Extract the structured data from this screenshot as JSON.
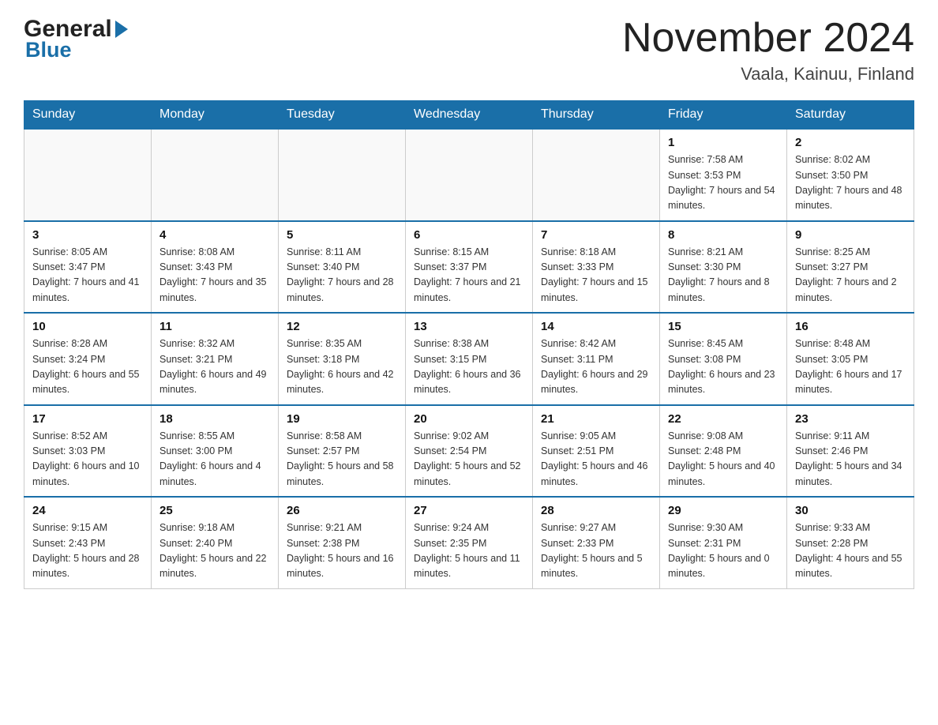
{
  "header": {
    "logo_general": "General",
    "logo_blue": "Blue",
    "month_title": "November 2024",
    "location": "Vaala, Kainuu, Finland"
  },
  "calendar": {
    "days_of_week": [
      "Sunday",
      "Monday",
      "Tuesday",
      "Wednesday",
      "Thursday",
      "Friday",
      "Saturday"
    ],
    "weeks": [
      [
        {
          "day": "",
          "info": ""
        },
        {
          "day": "",
          "info": ""
        },
        {
          "day": "",
          "info": ""
        },
        {
          "day": "",
          "info": ""
        },
        {
          "day": "",
          "info": ""
        },
        {
          "day": "1",
          "info": "Sunrise: 7:58 AM\nSunset: 3:53 PM\nDaylight: 7 hours and 54 minutes."
        },
        {
          "day": "2",
          "info": "Sunrise: 8:02 AM\nSunset: 3:50 PM\nDaylight: 7 hours and 48 minutes."
        }
      ],
      [
        {
          "day": "3",
          "info": "Sunrise: 8:05 AM\nSunset: 3:47 PM\nDaylight: 7 hours and 41 minutes."
        },
        {
          "day": "4",
          "info": "Sunrise: 8:08 AM\nSunset: 3:43 PM\nDaylight: 7 hours and 35 minutes."
        },
        {
          "day": "5",
          "info": "Sunrise: 8:11 AM\nSunset: 3:40 PM\nDaylight: 7 hours and 28 minutes."
        },
        {
          "day": "6",
          "info": "Sunrise: 8:15 AM\nSunset: 3:37 PM\nDaylight: 7 hours and 21 minutes."
        },
        {
          "day": "7",
          "info": "Sunrise: 8:18 AM\nSunset: 3:33 PM\nDaylight: 7 hours and 15 minutes."
        },
        {
          "day": "8",
          "info": "Sunrise: 8:21 AM\nSunset: 3:30 PM\nDaylight: 7 hours and 8 minutes."
        },
        {
          "day": "9",
          "info": "Sunrise: 8:25 AM\nSunset: 3:27 PM\nDaylight: 7 hours and 2 minutes."
        }
      ],
      [
        {
          "day": "10",
          "info": "Sunrise: 8:28 AM\nSunset: 3:24 PM\nDaylight: 6 hours and 55 minutes."
        },
        {
          "day": "11",
          "info": "Sunrise: 8:32 AM\nSunset: 3:21 PM\nDaylight: 6 hours and 49 minutes."
        },
        {
          "day": "12",
          "info": "Sunrise: 8:35 AM\nSunset: 3:18 PM\nDaylight: 6 hours and 42 minutes."
        },
        {
          "day": "13",
          "info": "Sunrise: 8:38 AM\nSunset: 3:15 PM\nDaylight: 6 hours and 36 minutes."
        },
        {
          "day": "14",
          "info": "Sunrise: 8:42 AM\nSunset: 3:11 PM\nDaylight: 6 hours and 29 minutes."
        },
        {
          "day": "15",
          "info": "Sunrise: 8:45 AM\nSunset: 3:08 PM\nDaylight: 6 hours and 23 minutes."
        },
        {
          "day": "16",
          "info": "Sunrise: 8:48 AM\nSunset: 3:05 PM\nDaylight: 6 hours and 17 minutes."
        }
      ],
      [
        {
          "day": "17",
          "info": "Sunrise: 8:52 AM\nSunset: 3:03 PM\nDaylight: 6 hours and 10 minutes."
        },
        {
          "day": "18",
          "info": "Sunrise: 8:55 AM\nSunset: 3:00 PM\nDaylight: 6 hours and 4 minutes."
        },
        {
          "day": "19",
          "info": "Sunrise: 8:58 AM\nSunset: 2:57 PM\nDaylight: 5 hours and 58 minutes."
        },
        {
          "day": "20",
          "info": "Sunrise: 9:02 AM\nSunset: 2:54 PM\nDaylight: 5 hours and 52 minutes."
        },
        {
          "day": "21",
          "info": "Sunrise: 9:05 AM\nSunset: 2:51 PM\nDaylight: 5 hours and 46 minutes."
        },
        {
          "day": "22",
          "info": "Sunrise: 9:08 AM\nSunset: 2:48 PM\nDaylight: 5 hours and 40 minutes."
        },
        {
          "day": "23",
          "info": "Sunrise: 9:11 AM\nSunset: 2:46 PM\nDaylight: 5 hours and 34 minutes."
        }
      ],
      [
        {
          "day": "24",
          "info": "Sunrise: 9:15 AM\nSunset: 2:43 PM\nDaylight: 5 hours and 28 minutes."
        },
        {
          "day": "25",
          "info": "Sunrise: 9:18 AM\nSunset: 2:40 PM\nDaylight: 5 hours and 22 minutes."
        },
        {
          "day": "26",
          "info": "Sunrise: 9:21 AM\nSunset: 2:38 PM\nDaylight: 5 hours and 16 minutes."
        },
        {
          "day": "27",
          "info": "Sunrise: 9:24 AM\nSunset: 2:35 PM\nDaylight: 5 hours and 11 minutes."
        },
        {
          "day": "28",
          "info": "Sunrise: 9:27 AM\nSunset: 2:33 PM\nDaylight: 5 hours and 5 minutes."
        },
        {
          "day": "29",
          "info": "Sunrise: 9:30 AM\nSunset: 2:31 PM\nDaylight: 5 hours and 0 minutes."
        },
        {
          "day": "30",
          "info": "Sunrise: 9:33 AM\nSunset: 2:28 PM\nDaylight: 4 hours and 55 minutes."
        }
      ]
    ]
  }
}
